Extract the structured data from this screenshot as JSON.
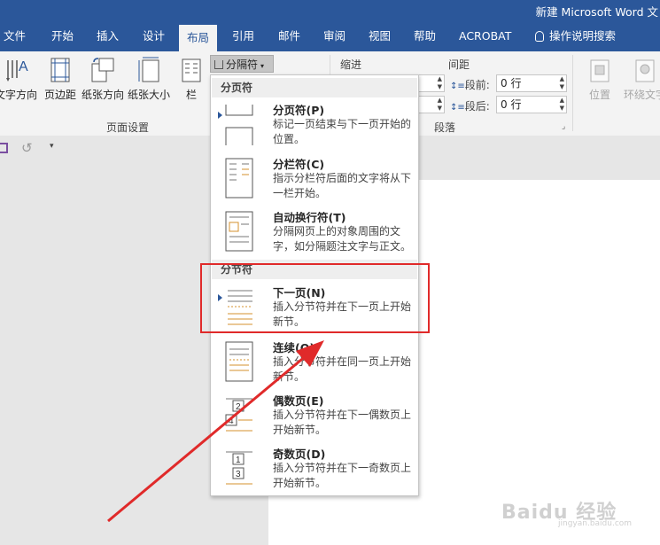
{
  "window": {
    "title": "新建 Microsoft Word 文"
  },
  "tabs": [
    "文件",
    "开始",
    "插入",
    "设计",
    "布局",
    "引用",
    "邮件",
    "审阅",
    "视图",
    "帮助",
    "ACROBAT"
  ],
  "active_tab": "布局",
  "tell_me": "操作说明搜索",
  "ribbon": {
    "page_setup": {
      "text_direction": "文字方向",
      "margins": "页边距",
      "orientation": "纸张方向",
      "size": "纸张大小",
      "columns": "栏",
      "group_label": "页面设置"
    },
    "breaks_button": "分隔符",
    "indent_label": "缩进",
    "spacing_label": "间距",
    "spacing_before_label": "段前:",
    "spacing_before_value": "0 行",
    "spacing_after_label": "段后:",
    "spacing_after_value": "0 行",
    "paragraph_group_label": "段落",
    "position": "位置",
    "wrap_text": "环绕文字"
  },
  "breaks_menu": {
    "page_breaks_header": "分页符",
    "section_breaks_header": "分节符",
    "items": [
      {
        "title": "分页符(P)",
        "desc": "标记一页结束与下一页开始的位置。"
      },
      {
        "title": "分栏符(C)",
        "desc": "指示分栏符后面的文字将从下一栏开始。"
      },
      {
        "title": "自动换行符(T)",
        "desc": "分隔网页上的对象周围的文字，如分隔题注文字与正文。"
      },
      {
        "title": "下一页(N)",
        "desc": "插入分节符并在下一页上开始新节。"
      },
      {
        "title": "连续(O)",
        "desc": "插入分节符并在同一页上开始新节。"
      },
      {
        "title": "偶数页(E)",
        "desc": "插入分节符并在下一偶数页上开始新节。"
      },
      {
        "title": "奇数页(D)",
        "desc": "插入分节符并在下一奇数页上开始新节。"
      }
    ]
  },
  "watermark": {
    "brand": "Baidu 经验",
    "url": "jingyan.baidu.com"
  },
  "colors": {
    "accent": "#2b579a",
    "annotation": "#e02a2a"
  }
}
